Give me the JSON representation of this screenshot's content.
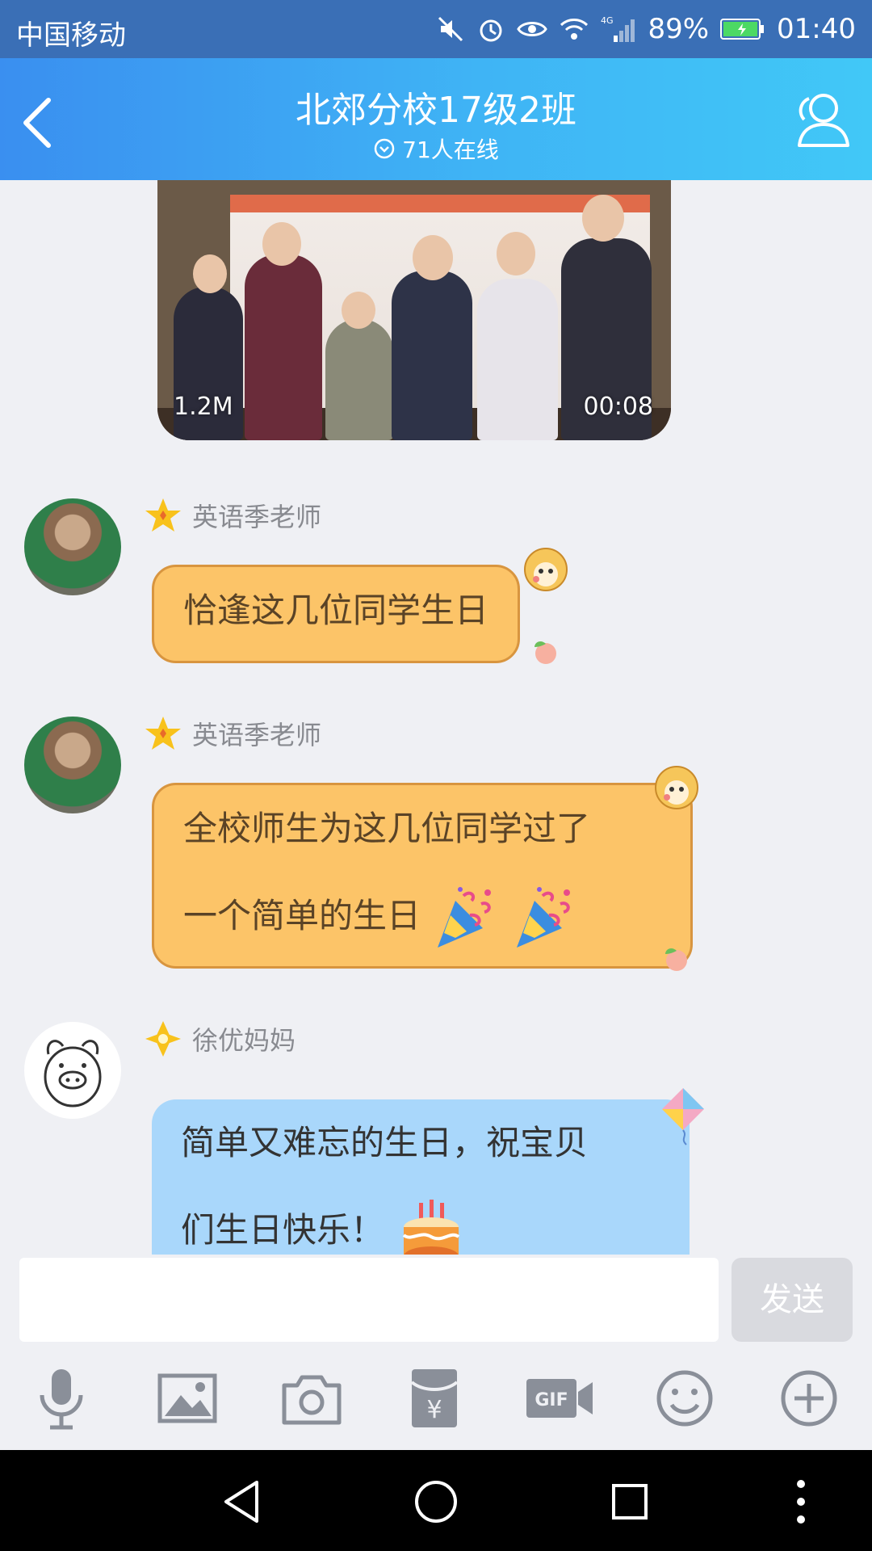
{
  "status_bar": {
    "carrier": "中国移动",
    "battery": "89%",
    "time": "01:40",
    "network": "4G"
  },
  "header": {
    "title": "北郊分校17级2班",
    "online": "71人在线"
  },
  "video": {
    "size": "1.2M",
    "duration": "00:08"
  },
  "messages": [
    {
      "sender": "英语季老师",
      "text": "恰逢这几位同学生日"
    },
    {
      "sender": "英语季老师",
      "line1": "全校师生为这几位同学过了",
      "line2": "一个简单的生日"
    },
    {
      "sender": "徐优妈妈",
      "line1": "简单又难忘的生日，祝宝贝",
      "line2": "们生日快乐！"
    }
  ],
  "input": {
    "placeholder": "",
    "send_label": "发送"
  },
  "toolbar": [
    "microphone-icon",
    "image-icon",
    "camera-icon",
    "red-packet-icon",
    "gif-icon",
    "emoji-icon",
    "plus-icon"
  ],
  "colors": {
    "status_bar": "#3a6fb6",
    "header_gradient_start": "#3a8ff0",
    "header_gradient_end": "#41c8f7",
    "bubble_orange": "#fcc468",
    "bubble_blue": "#a9d7fb",
    "background": "#eff0f4"
  }
}
